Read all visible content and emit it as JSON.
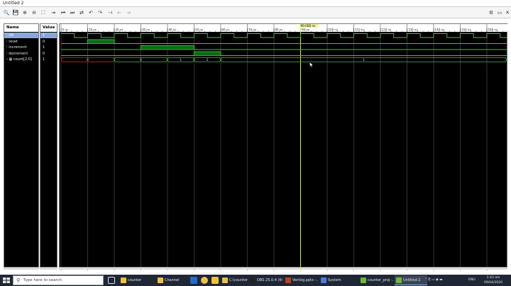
{
  "window": {
    "title": "Untitled 2"
  },
  "toolbar": {
    "buttons": [
      {
        "name": "zoom-search-icon",
        "glyph": "🔍"
      },
      {
        "name": "save-icon",
        "glyph": "💾"
      },
      {
        "name": "zoom-in-icon",
        "glyph": "⊕"
      },
      {
        "name": "zoom-out-icon",
        "glyph": "⊖"
      },
      {
        "name": "zoom-fit-icon",
        "glyph": "⛶"
      },
      {
        "name": "cursor-to-start-icon",
        "glyph": "⇥"
      },
      {
        "name": "go-to-start-icon",
        "glyph": "⏮"
      },
      {
        "name": "go-to-end-icon",
        "glyph": "⏭"
      },
      {
        "name": "swap-cursors-icon",
        "glyph": "⇄"
      },
      {
        "name": "previous-transition-icon",
        "glyph": "↶"
      },
      {
        "name": "next-transition-icon",
        "glyph": "↷"
      },
      {
        "name": "add-marker-icon",
        "glyph": "⊣"
      },
      {
        "name": "previous-marker-icon",
        "glyph": "⇤"
      },
      {
        "name": "next-marker-icon",
        "glyph": "⇥"
      }
    ],
    "right_buttons": [
      {
        "name": "settings-gear-icon",
        "glyph": "⚙"
      },
      {
        "name": "restore-icon",
        "glyph": "▭"
      },
      {
        "name": "close-icon",
        "glyph": "✕"
      }
    ]
  },
  "panel": {
    "name_header": "Name",
    "value_header": "Value"
  },
  "signals": [
    {
      "name": "clk",
      "value": "1",
      "selected": true
    },
    {
      "name": "reset",
      "value": "0",
      "selected": false
    },
    {
      "name": "increment",
      "value": "1",
      "selected": false
    },
    {
      "name": "decrement",
      "value": "0",
      "selected": false
    },
    {
      "name": "count[2:0]",
      "value": "1",
      "selected": false
    }
  ],
  "waveform": {
    "cursor_label": "90.000 ns",
    "timescale_labels": [
      "0 ns",
      "10 ns",
      "20 ns",
      "30 ns",
      "40 ns",
      "50 ns",
      "60 ns",
      "70 ns",
      "80 ns",
      "90 ns",
      "100 ns",
      "110 ns",
      "120 ns",
      "130 ns",
      "140 ns",
      "150 ns",
      "160 ns"
    ],
    "bus_values": [
      "X",
      "0",
      "1",
      "2",
      "1"
    ],
    "colors": {
      "signal": "#2ccf3a",
      "signal_fill": "#0a6b12",
      "bus": "#2ccf3a",
      "bus_x": "#e03030",
      "cursor": "#f3f37a",
      "grid": "#555555"
    }
  },
  "taskbar": {
    "search_placeholder": "Type here to search",
    "apps": [
      {
        "label": "counter",
        "color": "#f0c040"
      },
      {
        "label": "Channel",
        "color": "#f0c040"
      },
      {
        "label": "C:\\counter\\tb...",
        "color": "#f0c040"
      },
      {
        "label": "OBS 25.0.4 (64...",
        "color": "#222222"
      },
      {
        "label": "Verilog.pptx -...",
        "color": "#c43e1c"
      },
      {
        "label": "System",
        "color": "#4a7dd8"
      },
      {
        "label": "counter_proj -...",
        "color": "#6fb93a"
      },
      {
        "label": "Untitled 2",
        "color": "#6fb93a"
      }
    ],
    "tray_lang": "ENG",
    "clock_time": "1:43 am",
    "clock_date": "09/04/2020"
  }
}
